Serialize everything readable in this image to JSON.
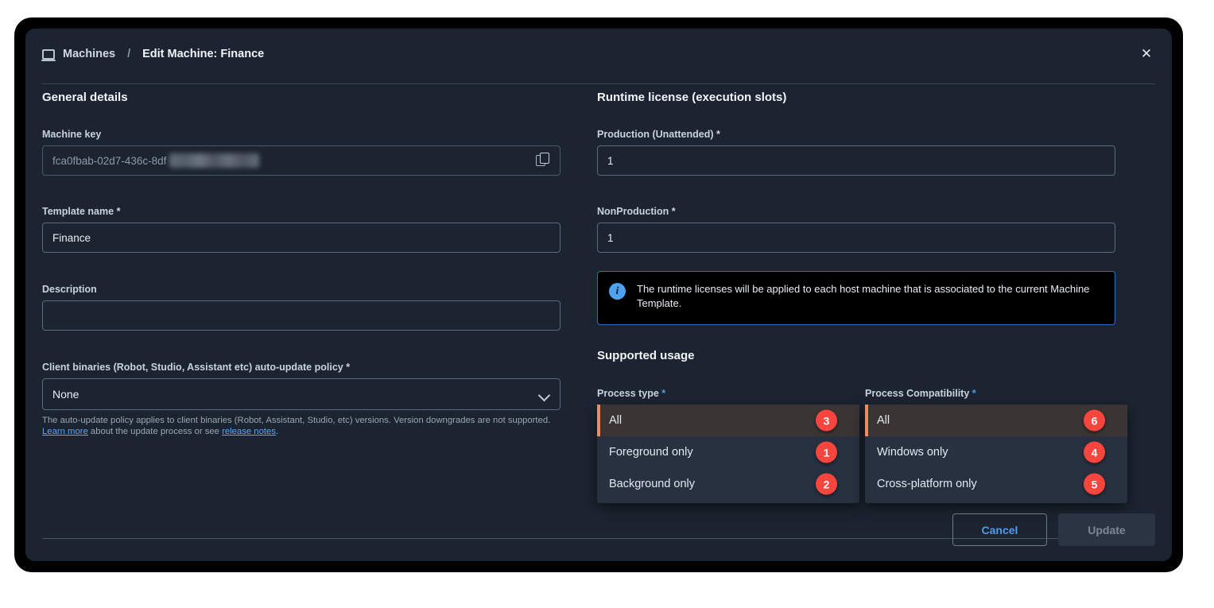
{
  "header": {
    "breadcrumb_root": "Machines",
    "breadcrumb_separator": "/",
    "breadcrumb_current": "Edit Machine: Finance",
    "root_icon": "monitor-icon",
    "close_label": "✕"
  },
  "left": {
    "section_title": "General details",
    "machine_key": {
      "label": "Machine key",
      "value": "fca0fbab-02d7-436c-8df",
      "copy_icon": "copy-icon"
    },
    "template_name": {
      "label": "Template name *",
      "value": "Finance",
      "placeholder": ""
    },
    "description": {
      "label": "Description",
      "value": "",
      "placeholder": ""
    },
    "auto_update": {
      "label": "Client binaries (Robot, Studio, Assistant etc) auto-update policy *",
      "value": "None",
      "chevron_icon": "chevron-down-icon",
      "helper_part1": "The auto-update policy applies to client binaries (Robot, Assistant, Studio, etc) versions. Version downgrades are not supported. ",
      "helper_link1": "Learn more",
      "helper_part2": " about the update process or see ",
      "helper_link2": "release notes",
      "helper_part3": "."
    }
  },
  "right": {
    "runtime_section_title": "Runtime license (execution slots)",
    "production": {
      "label": "Production (Unattended) *",
      "value": "1"
    },
    "nonproduction": {
      "label": "NonProduction *",
      "value": "1"
    },
    "info_banner": {
      "icon": "info-icon",
      "text": "The runtime licenses will be applied to each host machine that is associated to the current Machine Template."
    },
    "supported_usage_title": "Supported usage",
    "process_type": {
      "label": "Process type *",
      "options": [
        {
          "label": "All",
          "badge": "3",
          "selected": true
        },
        {
          "label": "Foreground only",
          "badge": "1",
          "selected": false
        },
        {
          "label": "Background only",
          "badge": "2",
          "selected": false
        }
      ]
    },
    "process_compatibility": {
      "label": "Process Compatibility *",
      "options": [
        {
          "label": "All",
          "badge": "6",
          "selected": true
        },
        {
          "label": "Windows only",
          "badge": "4",
          "selected": false
        },
        {
          "label": "Cross-platform only",
          "badge": "5",
          "selected": false
        }
      ]
    }
  },
  "footer": {
    "cancel_label": "Cancel",
    "update_label": "Update"
  },
  "colors": {
    "dialog_bg": "#1b2430",
    "badge_red": "#f8463f",
    "accent_orange": "#f18a62",
    "link_blue": "#5aa7f5",
    "info_border_blue": "#2d6fc4",
    "selected_row_bg": "#3a3434"
  }
}
